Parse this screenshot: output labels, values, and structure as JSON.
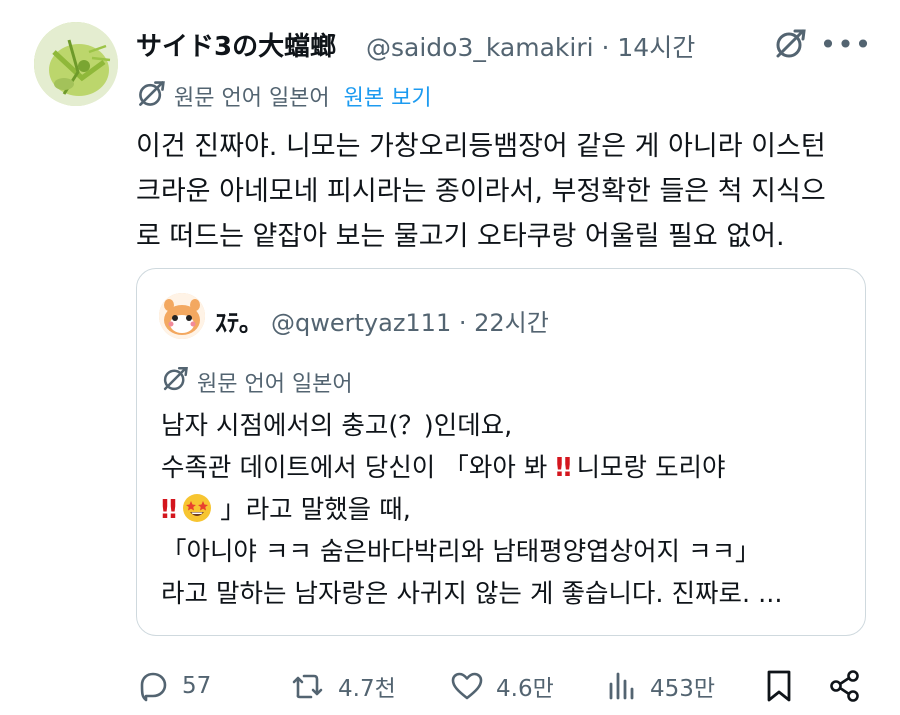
{
  "author": {
    "name": "サイド3の大蟷螂",
    "handle": "@saido3_kamakiri",
    "time": "14시간"
  },
  "translation": {
    "label": "원문 언어 일본어",
    "link": "원본 보기"
  },
  "post": {
    "lines": [
      "이건 진짜야. 니모는 가창오리등뱀장어 같은 게 아니라 이스턴",
      "크라운 아네모네 피시라는 종이라서, 부정확한 들은 척 지식으",
      "로 떠드는 얕잡아 보는 물고기 오타쿠랑 어울릴 필요 없어."
    ]
  },
  "quote": {
    "name": "ｽﾃ｡",
    "handle": "@qwertyaz111",
    "time": "22시간",
    "translation_label": "원문 언어 일본어",
    "line1": "남자 시점에서의 충고(？)인데요,",
    "line2_a": "수족관 데이트에서 당신이 「와아 봐",
    "bang": "‼",
    "line2_b": " 니모랑 도리야",
    "line3_b": "」라고 말했을 때,",
    "line4": "「아니야 ㅋㅋ 숨은바다박리와 남태평양엽상어지 ㅋㅋ」",
    "line5": "라고 말하는 남자랑은 사귀지 않는 게 좋습니다. 진짜로. ..."
  },
  "actions": {
    "replies": "57",
    "reposts": "4.7천",
    "likes": "4.6만",
    "views": "453만"
  },
  "colors": {
    "text": "#0f1419",
    "secondary": "#536471",
    "link": "#1d9bf0",
    "border": "#cfd9de"
  },
  "icons": [
    "grok-icon",
    "more-icon",
    "translate-icon",
    "reply-icon",
    "repost-icon",
    "like-icon",
    "views-icon",
    "bookmark-icon",
    "share-icon"
  ]
}
